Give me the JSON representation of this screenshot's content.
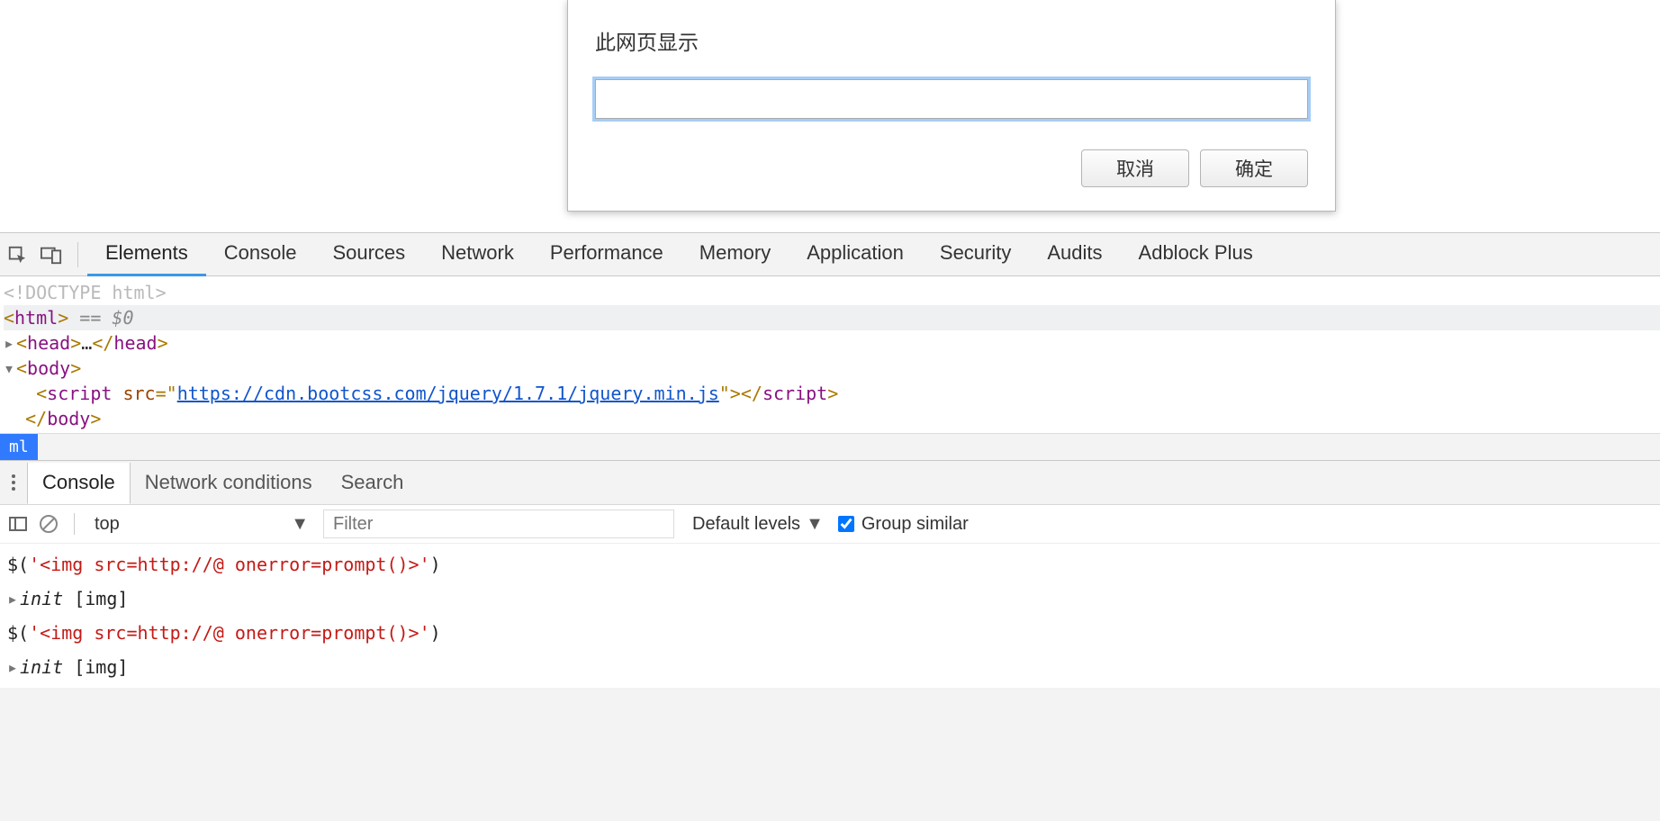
{
  "dialog": {
    "title": "此网页显示",
    "input_value": "",
    "cancel_label": "取消",
    "ok_label": "确定"
  },
  "devtools": {
    "tabs": [
      "Elements",
      "Console",
      "Sources",
      "Network",
      "Performance",
      "Memory",
      "Application",
      "Security",
      "Audits",
      "Adblock Plus"
    ],
    "active_tab": "Elements"
  },
  "dom": {
    "doctype": "<!DOCTYPE html>",
    "html_open": "html",
    "selected_suffix": " == $0",
    "head_open": "head",
    "head_ellipsis": "…",
    "head_close": "head",
    "body_open": "body",
    "script_tag": "script",
    "script_attr": "src",
    "script_src": "https://cdn.bootcss.com/jquery/1.7.1/jquery.min.js",
    "body_close": "body"
  },
  "breadcrumb": {
    "item": "ml"
  },
  "drawer": {
    "tabs": [
      "Console",
      "Network conditions",
      "Search"
    ],
    "active_tab": "Console"
  },
  "console_toolbar": {
    "context": "top",
    "filter_placeholder": "Filter",
    "levels_label": "Default levels",
    "group_similar_label": "Group similar",
    "group_similar_checked": true
  },
  "console": {
    "lines": [
      {
        "type": "input",
        "code_prefix": "$(",
        "code_str": "'<img src=http://@ onerror=prompt()>'",
        "code_suffix": ")"
      },
      {
        "type": "result",
        "expand": true,
        "italic": "init ",
        "bracket": "[img]"
      },
      {
        "type": "input",
        "code_prefix": "$(",
        "code_str": "'<img src=http://@ onerror=prompt()>'",
        "code_suffix": ")"
      },
      {
        "type": "result",
        "expand": true,
        "italic": "init ",
        "bracket": "[img]"
      }
    ]
  }
}
